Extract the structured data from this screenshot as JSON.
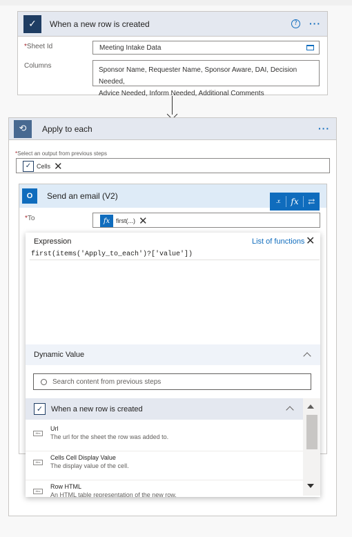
{
  "trigger": {
    "title": "When a new row is created",
    "help": "?",
    "more": "···",
    "fields": [
      {
        "label": "Sheet Id",
        "required_mark": "*",
        "value": "Meeting Intake Data"
      },
      {
        "label": "Columns",
        "value_lines": [
          "Sponsor Name, Requester Name, Sponsor Aware, DAI, Decision Needed,",
          "Advice Needed, Inform Needed, Additional Comments"
        ]
      }
    ]
  },
  "apply": {
    "title": "Apply to each",
    "more": "···",
    "output_label": "Select an output from previous steps",
    "required_mark": "*",
    "token": "Cells"
  },
  "email": {
    "title": "Send an email (V2)",
    "to_label": "To",
    "required_mark": "*",
    "to_token": "first(...)",
    "fx_symbol": "fx"
  },
  "popup": {
    "tab_label": "Expression",
    "functions_link": "List of functions",
    "expression": "first(items('Apply_to_each')?['value'])",
    "dynamic_label": "Dynamic Value",
    "search_placeholder": "Search content from previous steps",
    "section_title": "When a new row is created",
    "badge": "Abc",
    "items": [
      {
        "name": "Url",
        "desc": "The url for the sheet the row was added to."
      },
      {
        "name": "Cells Cell Display Value",
        "desc": "The display value of the cell."
      },
      {
        "name": "Row HTML",
        "desc": "An HTML table representation of the new row."
      }
    ]
  },
  "colors": {
    "accent": "#0f6cbd",
    "header_bg": "#e4e8f0",
    "email_header_bg": "#deebf7",
    "brand_dark": "#1f3d63"
  }
}
